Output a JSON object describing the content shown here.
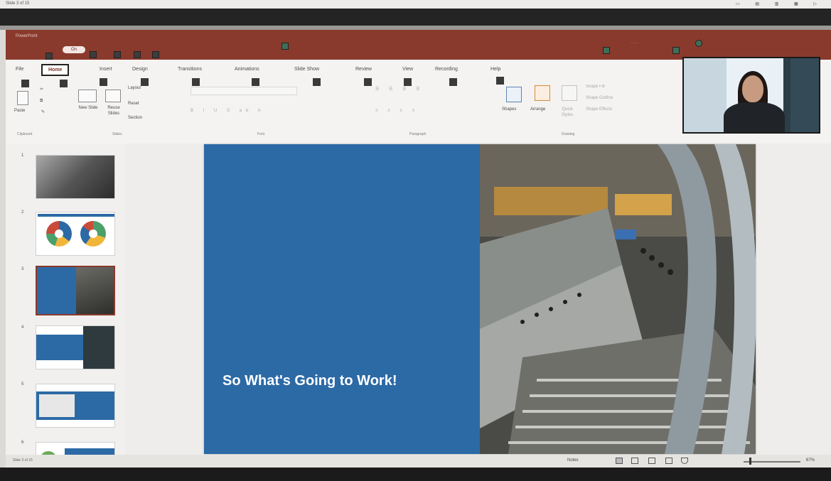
{
  "app": {
    "name": "PowerPoint",
    "document_title": "",
    "autosave_label": "On"
  },
  "top_strip": {
    "left_text": "Slide 3 of 15",
    "right_icons": [
      "notes-icon",
      "normal-view-icon",
      "sorter-icon",
      "reading-icon",
      "slideshow-icon"
    ]
  },
  "ribbon": {
    "tabs": [
      "File",
      "Home",
      "Insert",
      "Design",
      "Transitions",
      "Animations",
      "Slide Show",
      "Review",
      "View",
      "Recording",
      "Help"
    ],
    "active_tab": "Home",
    "groups": {
      "clipboard": "Clipboard",
      "slides": "Slides",
      "font": "Font",
      "paragraph": "Paragraph",
      "drawing": "Drawing"
    },
    "buttons": {
      "paste": "Paste",
      "new_slide": "New Slide",
      "reuse_slides": "Reuse Slides",
      "layout": "Layout",
      "reset": "Reset",
      "section": "Section",
      "shapes": "Shapes",
      "arrange": "Arrange",
      "quick_styles": "Quick Styles",
      "shape_fill": "Shape Fill",
      "shape_outline": "Shape Outline",
      "shape_effects": "Shape Effects"
    }
  },
  "thumbnails": [
    {
      "num": "1"
    },
    {
      "num": "2"
    },
    {
      "num": "3"
    },
    {
      "num": "4"
    },
    {
      "num": "5"
    },
    {
      "num": "6"
    }
  ],
  "slide": {
    "title": "So What's Going to Work!"
  },
  "status": {
    "left": "Slide 3 of 15",
    "notes": "Notes",
    "zoom": "67%"
  },
  "colors": {
    "title_bar": "#8a3a2c",
    "slide_blue": "#2c6aa6",
    "accent": "#7a3226"
  }
}
